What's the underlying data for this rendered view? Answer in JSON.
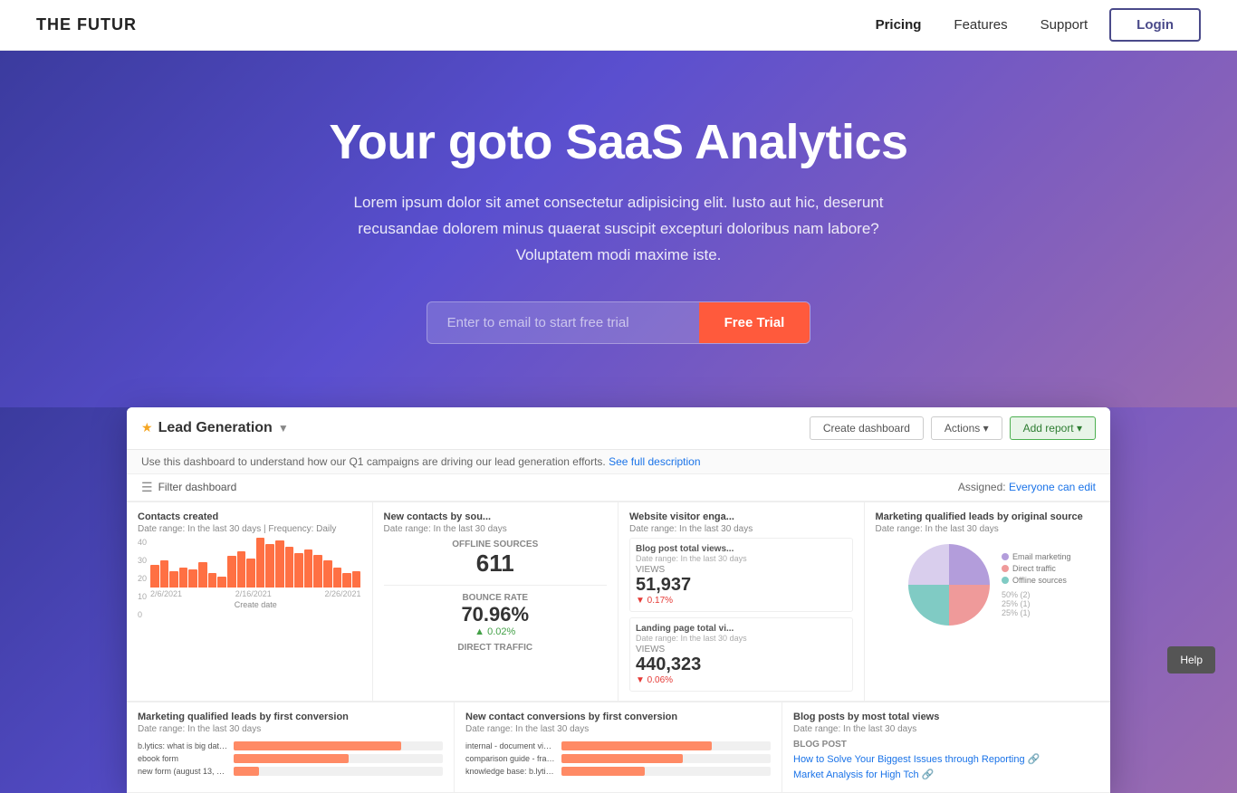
{
  "nav": {
    "logo": "THE FUTUR",
    "links": [
      {
        "label": "Pricing",
        "active": true
      },
      {
        "label": "Features",
        "active": false
      },
      {
        "label": "Support",
        "active": false
      }
    ],
    "login_label": "Login"
  },
  "hero": {
    "title": "Your goto SaaS Analytics",
    "subtitle": "Lorem ipsum dolor sit amet consectetur adipisicing elit. Iusto aut hic, deserunt recusandae dolorem minus quaerat suscipit excepturi doloribus nam labore? Voluptatem modi maxime iste.",
    "input_placeholder": "Enter to email to start free trial",
    "cta_label": "Free Trial"
  },
  "dashboard": {
    "star": "★",
    "title": "Lead Generation",
    "chevron": "▼",
    "btn_create": "Create dashboard",
    "btn_actions": "Actions ▾",
    "btn_add": "Add report ▾",
    "desc": "Use this dashboard to understand how our Q1 campaigns are driving our lead generation efforts.",
    "desc_link": "See full description",
    "filter_label": "Filter dashboard",
    "assigned_label": "Assigned:",
    "assigned_link": "Everyone can edit",
    "cells": [
      {
        "title": "Contacts created",
        "range": "Date range: In the last 30 days | Frequency: Daily",
        "type": "bar"
      },
      {
        "title": "New contacts by sou...",
        "range": "Date range: In the last 30 days",
        "type": "metric-double",
        "top_label": "OFFLINE SOURCES",
        "top_value": "611",
        "bottom_label": "BOUNCE RATE",
        "bottom_value": "70.96%",
        "bottom_change": "▲ 0.02%",
        "bottom_change_dir": "up",
        "section2_label": "DIRECT TRAFFIC"
      },
      {
        "title": "Website visitor enga...",
        "range": "Date range: In the last 30 days",
        "type": "metric-double",
        "top_label": "Blog post total views...",
        "top_range": "Date range: In the last 30 days",
        "top_metric_label": "VIEWS",
        "top_value": "51,937",
        "top_change": "▼ 0.17%",
        "top_change_dir": "down",
        "bottom_label": "Landing page total vi...",
        "bottom_range": "Date range: In the last 30 days",
        "bottom_metric_label": "VIEWS",
        "bottom_value": "440,323",
        "bottom_change": "▼ 0.06%",
        "bottom_change_dir": "down"
      },
      {
        "title": "Marketing qualified leads by original source",
        "range": "Date range: In the last 30 days",
        "type": "pie",
        "legend": [
          {
            "label": "Email marketing",
            "color": "#b39ddb"
          },
          {
            "label": "Direct traffic",
            "color": "#ef9a9a"
          },
          {
            "label": "Offline sources",
            "color": "#80cbc4"
          }
        ],
        "slices": [
          {
            "value": 50,
            "color": "#b39ddb",
            "pct": "50% (2)"
          },
          {
            "value": 25,
            "color": "#ef9a9a",
            "pct": "25% (1)"
          },
          {
            "value": 25,
            "color": "#80cbc4",
            "pct": "25% (1)"
          }
        ]
      }
    ],
    "cells2": [
      {
        "title": "Marketing qualified leads by first conversion",
        "range": "Date range: In the last 30 days",
        "type": "hbar",
        "bars": [
          {
            "label": "b.lytics: what is big data:...",
            "value": 80,
            "color": "#ff8a65"
          },
          {
            "label": "ebook form",
            "value": 55,
            "color": "#ff8a65"
          },
          {
            "label": "new form (august 13, 2020",
            "value": 12,
            "color": "#ff8a65"
          }
        ]
      },
      {
        "title": "New contact conversions by first conversion",
        "range": "Date range: In the last 30 days",
        "type": "hbar",
        "bars": [
          {
            "label": "internal - document viewe...",
            "value": 72,
            "color": "#ff8a65"
          },
          {
            "label": "comparison guide - frame...",
            "value": 58,
            "color": "#ff8a65"
          },
          {
            "label": "knowledge base: b.lytics ...",
            "value": 40,
            "color": "#ff8a65"
          }
        ]
      },
      {
        "title": "Blog posts by most total views",
        "range": "Date range: In the last 30 days",
        "type": "blog-list",
        "tag": "BLOG POST",
        "items": [
          {
            "text": "How to Solve Your Biggest Issues through Reporting 🔗",
            "link": true
          },
          {
            "text": "Market Analysis for High Tch 🔗",
            "link": true
          }
        ]
      }
    ]
  },
  "help": {
    "label": "Help"
  }
}
